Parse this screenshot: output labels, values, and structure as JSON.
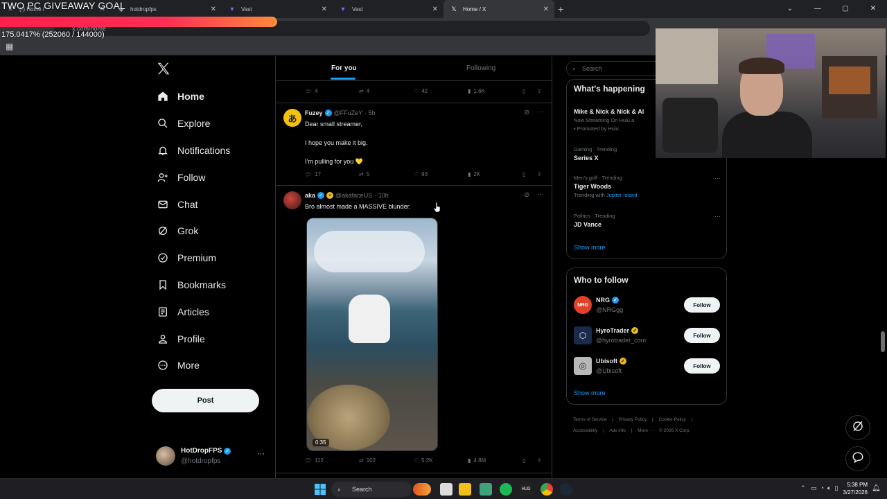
{
  "overlay": {
    "goal_title": "TWO PC GIVEAWAY GOAL",
    "goal_progress_text": "175.0417% (252060 / 144000)"
  },
  "browser": {
    "tabs": [
      {
        "label": "(-) Home /",
        "icon": "x-icon"
      },
      {
        "label": "hotdropfps",
        "icon": "twitch-icon"
      },
      {
        "label": "Vast",
        "icon": "vast-icon"
      },
      {
        "label": "Vast",
        "icon": "vast-icon"
      },
      {
        "label": "Home / X",
        "icon": "x-icon"
      }
    ],
    "url": "x.com/home"
  },
  "nav": {
    "items": [
      {
        "label": "Home",
        "icon": "home-icon"
      },
      {
        "label": "Explore",
        "icon": "search-icon"
      },
      {
        "label": "Notifications",
        "icon": "bell-icon"
      },
      {
        "label": "Follow",
        "icon": "follow-icon"
      },
      {
        "label": "Chat",
        "icon": "mail-icon"
      },
      {
        "label": "Grok",
        "icon": "grok-icon"
      },
      {
        "label": "Premium",
        "icon": "premium-icon"
      },
      {
        "label": "Bookmarks",
        "icon": "bookmark-icon"
      },
      {
        "label": "Articles",
        "icon": "articles-icon"
      },
      {
        "label": "Profile",
        "icon": "profile-icon"
      },
      {
        "label": "More",
        "icon": "more-icon"
      }
    ],
    "post_label": "Post",
    "user": {
      "name": "HotDropFPS",
      "handle": "@hotdropfps"
    }
  },
  "feed": {
    "tabs": {
      "for_you": "For you",
      "following": "Following"
    },
    "prev_actions": {
      "replies": "4",
      "reposts": "4",
      "likes": "42",
      "views": "1.6K"
    },
    "tweets": [
      {
        "name": "Fuzey",
        "handle": "@FFuZeY",
        "time": "· 5h",
        "lines": [
          "Dear small streamer,",
          "I hope you make it big.",
          "I'm pulling for you 💛"
        ],
        "actions": {
          "replies": "17",
          "reposts": "5",
          "likes": "93",
          "views": "2K"
        }
      },
      {
        "name": "aka",
        "handle": "@akafaceUS",
        "time": "· 10h",
        "lines": [
          "Bro almost made a MASSIVE blunder."
        ],
        "video_duration": "0:35",
        "actions": {
          "replies": "112",
          "reposts": "102",
          "likes": "5.2K",
          "views": "4.8M"
        }
      }
    ]
  },
  "sidebar": {
    "search_placeholder": "Search",
    "happening_title": "What's happening",
    "trends": [
      {
        "meta": "",
        "title": "Mike & Nick & Nick & Al",
        "sub": "Now Streaming On Hulu a",
        "promo": "Promoted by Hulu"
      },
      {
        "meta": "Gaming · Trending",
        "title": "Series X",
        "sub": ""
      },
      {
        "meta": "Men's golf · Trending",
        "title": "Tiger Woods",
        "sub_prefix": "Trending with",
        "sub_link": "Jupiter Island"
      },
      {
        "meta": "Politics · Trending",
        "title": "JD Vance",
        "sub": ""
      }
    ],
    "show_more": "Show more",
    "wtf_title": "Who to follow",
    "who_to_follow": [
      {
        "name": "NRG",
        "handle": "@NRGgg",
        "badge": "blue",
        "avatar_color": "#e0422c"
      },
      {
        "name": "HyroTrader",
        "handle": "@hyrotrader_com",
        "badge": "gold",
        "avatar_color": "#1b2a4a"
      },
      {
        "name": "Ubisoft",
        "handle": "@Ubisoft",
        "badge": "gold",
        "avatar_color": "#b8b8b8"
      }
    ],
    "follow_label": "Follow",
    "footer": [
      "Terms of Service",
      "|",
      "Privacy Policy",
      "|",
      "Cookie Policy",
      "|",
      "Accessibility",
      "|",
      "Ads info",
      "|",
      "More ···",
      "© 2026 X Corp."
    ]
  },
  "taskbar": {
    "search_label": "Search",
    "time": "5:38 PM",
    "date": "3/27/2026"
  }
}
